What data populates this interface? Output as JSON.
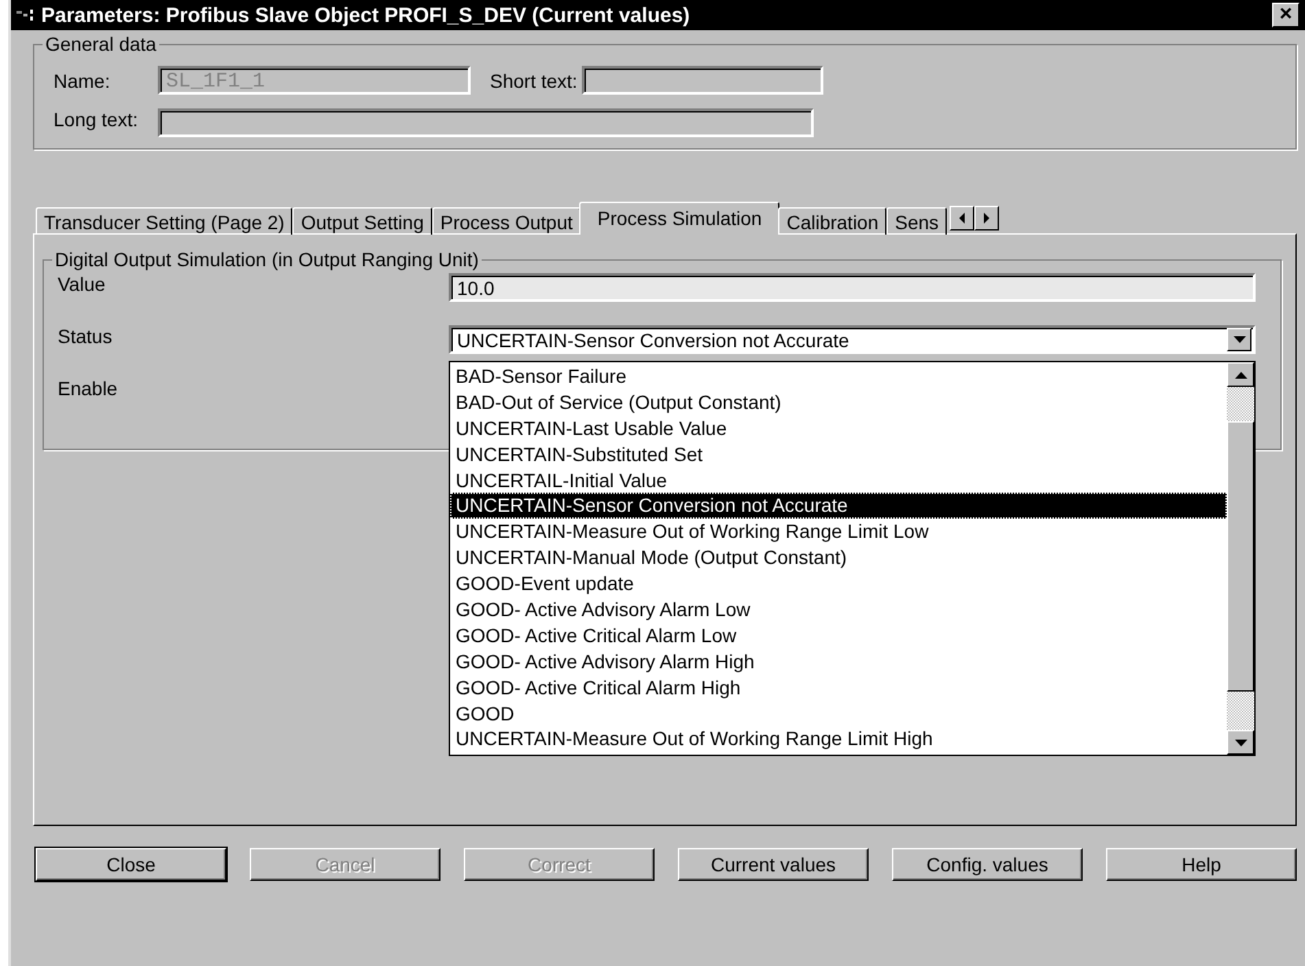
{
  "window": {
    "title": "Parameters: Profibus Slave Object PROFI_S_DEV (Current values)",
    "close": "×"
  },
  "general": {
    "legend": "General data",
    "name": {
      "label": "Name:",
      "value": "SL_1F1_1",
      "disabled": true
    },
    "short_text": {
      "label": "Short text:"
    },
    "long_text": {
      "label": "Long text:"
    }
  },
  "tabs": [
    {
      "label": "Transducer Setting (Page 2)",
      "selected": false
    },
    {
      "label": "Output Setting",
      "selected": false
    },
    {
      "label": "Process Output",
      "selected": false
    },
    {
      "label": "Process Simulation",
      "selected": true
    },
    {
      "label": "Calibration",
      "selected": false
    },
    {
      "label": "Sens",
      "selected": false
    }
  ],
  "simulation": {
    "legend": "Digital Output Simulation (in Output Ranging Unit)",
    "value": {
      "label": "Value",
      "value": "10.0"
    },
    "status": {
      "label": "Status",
      "value": "UNCERTAIN-Sensor Conversion not Accurate",
      "expanded": true
    },
    "enable": {
      "label": "Enable"
    }
  },
  "status_options": [
    {
      "label": "BAD-Sensor Failure",
      "selected": false
    },
    {
      "label": "BAD-Out of Service (Output Constant)",
      "selected": false
    },
    {
      "label": "UNCERTAIN-Last Usable Value",
      "selected": false
    },
    {
      "label": "UNCERTAIN-Substituted Set",
      "selected": false
    },
    {
      "label": "UNCERTAIL-Initial Value",
      "selected": false
    },
    {
      "label": "UNCERTAIN-Sensor Conversion not Accurate",
      "selected": true
    },
    {
      "label": "UNCERTAIN-Measure Out of Working Range Limit Low",
      "selected": false
    },
    {
      "label": "UNCERTAIN-Manual Mode (Output Constant)",
      "selected": false
    },
    {
      "label": "GOOD-Event update",
      "selected": false
    },
    {
      "label": "GOOD- Active Advisory Alarm Low",
      "selected": false
    },
    {
      "label": "GOOD- Active Critical Alarm Low",
      "selected": false
    },
    {
      "label": "GOOD- Active Advisory Alarm High",
      "selected": false
    },
    {
      "label": "GOOD- Active Critical Alarm High",
      "selected": false
    },
    {
      "label": "GOOD",
      "selected": false
    },
    {
      "label": "UNCERTAIN-Measure Out of Working Range Limit High",
      "selected": false
    }
  ],
  "buttons": [
    {
      "label": "Close",
      "disabled": false,
      "default": true
    },
    {
      "label": "Cancel",
      "disabled": true,
      "default": false
    },
    {
      "label": "Correct",
      "disabled": true,
      "default": false
    },
    {
      "label": "Current values",
      "disabled": false,
      "default": false
    },
    {
      "label": "Config. values",
      "disabled": false,
      "default": false
    },
    {
      "label": "Help",
      "disabled": false,
      "default": false
    }
  ]
}
